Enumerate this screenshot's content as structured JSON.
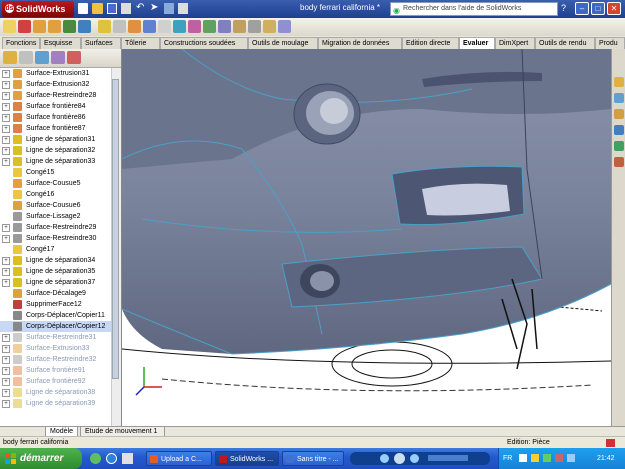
{
  "window": {
    "app_name": "SolidWorks",
    "document_title": "body ferrari california *"
  },
  "search": {
    "placeholder": "Rechercher dans l'aide de SolidWorks"
  },
  "tabs": [
    {
      "label": "Fonctions"
    },
    {
      "label": "Esquisse"
    },
    {
      "label": "Surfaces"
    },
    {
      "label": "Tôlerie"
    },
    {
      "label": "Constructions soudées"
    },
    {
      "label": "Outils de moulage"
    },
    {
      "label": "Migration de données"
    },
    {
      "label": "Edition directe"
    },
    {
      "label": "Evaluer"
    },
    {
      "label": "DimXpert"
    },
    {
      "label": "Outils de rendu"
    },
    {
      "label": "Produ"
    }
  ],
  "tree": [
    {
      "label": "Surface-Extrusion31",
      "exp": "+",
      "dim": false,
      "color": "#e0a040"
    },
    {
      "label": "Surface-Extrusion32",
      "exp": "+",
      "dim": false,
      "color": "#e0a040"
    },
    {
      "label": "Surface-Restreindre28",
      "exp": "+",
      "dim": false,
      "color": "#e0a040"
    },
    {
      "label": "Surface frontière84",
      "exp": "+",
      "dim": false,
      "color": "#e08040"
    },
    {
      "label": "Surface frontière86",
      "exp": "+",
      "dim": false,
      "color": "#e08040"
    },
    {
      "label": "Surface frontière87",
      "exp": "+",
      "dim": false,
      "color": "#e08040"
    },
    {
      "label": "Ligne de séparation31",
      "exp": "+",
      "dim": false,
      "color": "#d8c020"
    },
    {
      "label": "Ligne de séparation32",
      "exp": "+",
      "dim": false,
      "color": "#d8c020"
    },
    {
      "label": "Ligne de séparation33",
      "exp": "+",
      "dim": false,
      "color": "#d8c020"
    },
    {
      "label": "Congé15",
      "exp": "",
      "dim": false,
      "color": "#e8c840"
    },
    {
      "label": "Surface-Cousue5",
      "exp": "",
      "dim": false,
      "color": "#e0a040"
    },
    {
      "label": "Congé16",
      "exp": "",
      "dim": false,
      "color": "#e8c840"
    },
    {
      "label": "Surface-Cousue6",
      "exp": "",
      "dim": false,
      "color": "#e0a040"
    },
    {
      "label": "Surface-Lissage2",
      "exp": "",
      "dim": false,
      "color": "#9a9a9a"
    },
    {
      "label": "Surface-Restreindre29",
      "exp": "+",
      "dim": false,
      "color": "#9a9a9a"
    },
    {
      "label": "Surface-Restreindre30",
      "exp": "+",
      "dim": false,
      "color": "#9a9a9a"
    },
    {
      "label": "Congé17",
      "exp": "",
      "dim": false,
      "color": "#e8c840"
    },
    {
      "label": "Ligne de séparation34",
      "exp": "+",
      "dim": false,
      "color": "#d8c020"
    },
    {
      "label": "Ligne de séparation35",
      "exp": "+",
      "dim": false,
      "color": "#d8c020"
    },
    {
      "label": "Ligne de séparation37",
      "exp": "+",
      "dim": false,
      "color": "#d8c020"
    },
    {
      "label": "Surface-Décalage9",
      "exp": "",
      "dim": false,
      "color": "#e0a040"
    },
    {
      "label": "SupprimerFace12",
      "exp": "",
      "dim": false,
      "color": "#c04040"
    },
    {
      "label": "Corps-Déplacer/Copier11",
      "exp": "",
      "dim": false,
      "color": "#888888"
    },
    {
      "label": "Corps-Déplacer/Copier12",
      "exp": "",
      "dim": false,
      "color": "#888888"
    },
    {
      "label": "Surface-Restreindre31",
      "exp": "+",
      "dim": true,
      "color": "#9a9a9a"
    },
    {
      "label": "Surface-Extrusion33",
      "exp": "+",
      "dim": true,
      "color": "#e0a040"
    },
    {
      "label": "Surface-Restreindre32",
      "exp": "+",
      "dim": true,
      "color": "#9a9a9a"
    },
    {
      "label": "Surface frontière91",
      "exp": "+",
      "dim": true,
      "color": "#e08040"
    },
    {
      "label": "Surface frontière92",
      "exp": "+",
      "dim": true,
      "color": "#e08040"
    },
    {
      "label": "Ligne de séparation38",
      "exp": "+",
      "dim": true,
      "color": "#d8c020"
    },
    {
      "label": "Ligne de séparation39",
      "exp": "+",
      "dim": true,
      "color": "#d8c020"
    }
  ],
  "bottom_tabs": [
    {
      "label": "Modèle"
    },
    {
      "label": "Etude de mouvement 1"
    }
  ],
  "status": {
    "left": "body ferrari california",
    "right": "Edition: Pièce"
  },
  "taskbar": {
    "start_label": "démarrer",
    "tasks": [
      {
        "label": "Upload a C...",
        "color": "#e06020"
      },
      {
        "label": "SolidWorks ...",
        "color": "#c01818"
      },
      {
        "label": "Sans titre - ...",
        "color": "#4070d0"
      }
    ],
    "lang": "FR",
    "clock": "21:42"
  }
}
